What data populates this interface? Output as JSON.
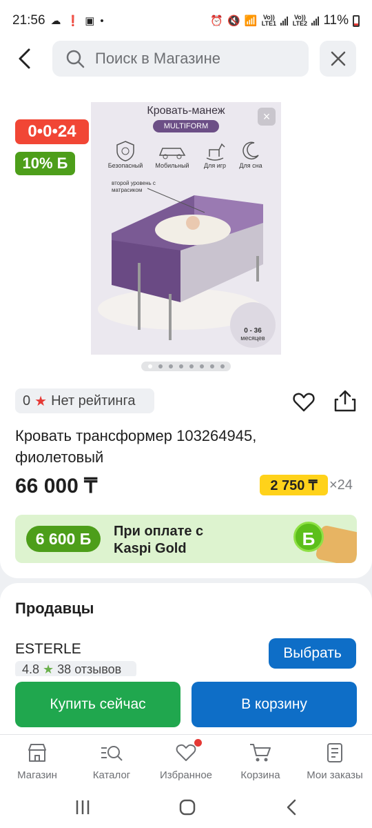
{
  "status_bar": {
    "time": "21:56",
    "lte1": "Vo)) LTE1",
    "lte2": "Vo)) LTE2",
    "battery": "11%"
  },
  "header": {
    "search_placeholder": "Поиск в Магазине"
  },
  "product": {
    "timer": "0•0•24",
    "bonus_badge": "10% Б",
    "image": {
      "heading": "Кровать-манеж",
      "brand": "MULTIFORM",
      "features": [
        "Безопасный",
        "Мобильный",
        "Для игр",
        "Для сна"
      ],
      "callout": "второй уровень с матрасиком",
      "age_range": "0 - 36",
      "age_unit": "месяцев"
    },
    "carousel_total": 8,
    "carousel_active": 1,
    "rating_count": "0",
    "rating_text": "Нет рейтинга",
    "title": "Кровать трансформер 103264945, фиолетовый",
    "price": "66 000 ₸",
    "installment_amount": "2 750 ₸",
    "installment_months": "×24",
    "gold_bonus": "6 600 Б",
    "gold_text_line1": "При оплате с",
    "gold_text_line2": "Kaspi Gold",
    "gold_coin": "Б"
  },
  "sellers": {
    "title": "Продавцы",
    "items": [
      {
        "name": "ESTERLE",
        "rating": "4.8",
        "reviews": "38 отзывов",
        "button": "Выбрать"
      }
    ]
  },
  "actions": {
    "buy_now": "Купить сейчас",
    "add_to_cart": "В корзину"
  },
  "tabs": [
    {
      "label": "Магазин",
      "icon": "store-icon"
    },
    {
      "label": "Каталог",
      "icon": "catalog-icon"
    },
    {
      "label": "Избранное",
      "icon": "heart-icon"
    },
    {
      "label": "Корзина",
      "icon": "cart-icon"
    },
    {
      "label": "Мои заказы",
      "icon": "orders-icon"
    }
  ],
  "colors": {
    "accent_blue": "#0e6ec7",
    "buy_green": "#20a74e",
    "timer_red": "#f14635",
    "bonus_green": "#4d9e1a",
    "installment_yellow": "#ffd21a"
  }
}
